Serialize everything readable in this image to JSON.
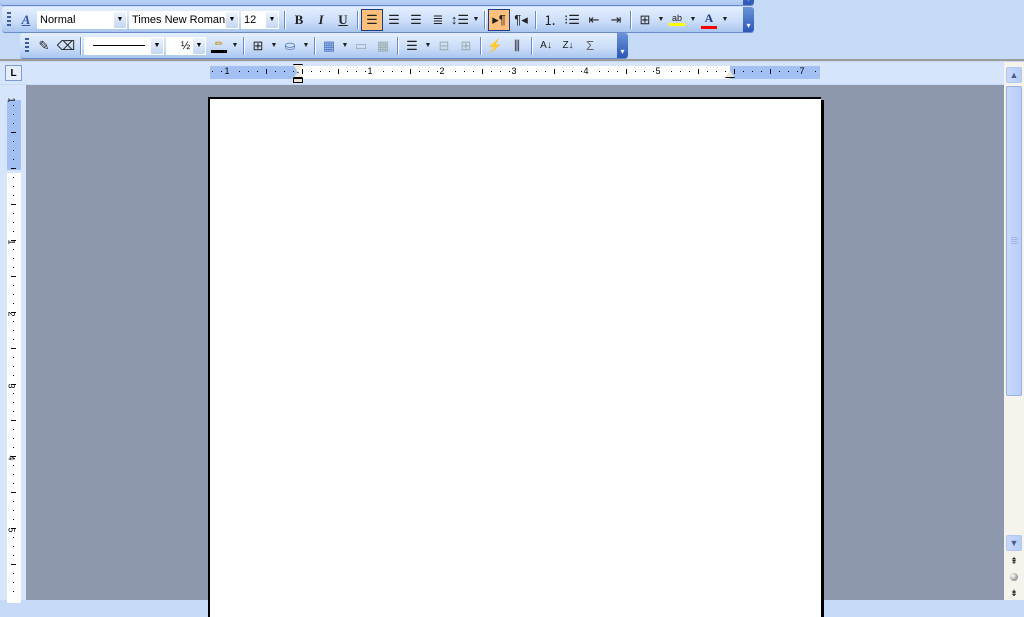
{
  "formatting_toolbar": {
    "style_value": "Normal",
    "font_value": "Times New Roman",
    "size_value": "12",
    "bold_label": "B",
    "italic_label": "I",
    "underline_label": "U",
    "active_alignment": "align-left",
    "ltr_active": true,
    "highlight_color": "#ffff00",
    "font_color": "#ff0000"
  },
  "tables_toolbar": {
    "line_weight_value": "½",
    "sum_label": "Σ",
    "border_color": "#000000"
  },
  "ruler": {
    "horizontal_numbers": [
      "1",
      "1",
      "2",
      "3",
      "4",
      "5",
      "7"
    ],
    "vertical_numbers": [
      "1",
      "1",
      "2",
      "3",
      "4",
      "5"
    ],
    "tab_selector": "L"
  },
  "colors": {
    "toolbar_bg": "#c4daf7",
    "workspace_bg": "#8e98ad",
    "active_button": "#ffc07c",
    "ruler_margin": "#a3c0f5"
  }
}
